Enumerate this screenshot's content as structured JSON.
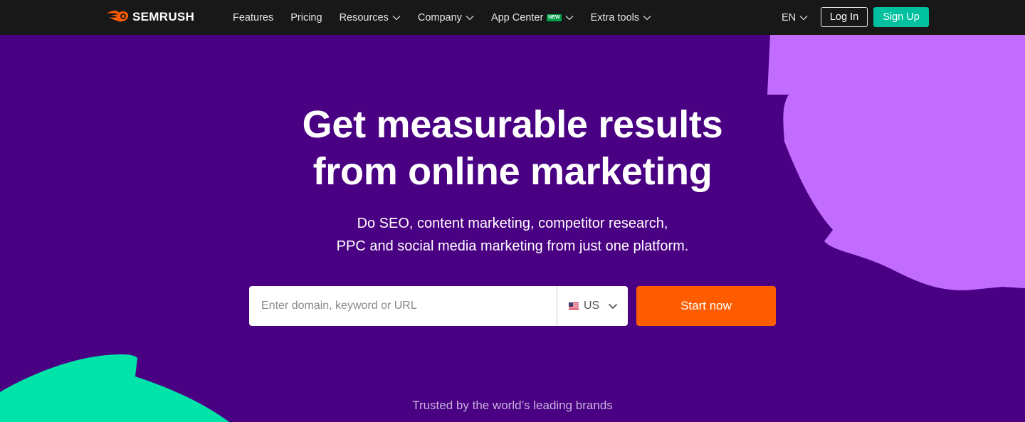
{
  "header": {
    "logo_text": "SEMRUSH",
    "nav": [
      {
        "label": "Features",
        "has_dropdown": false
      },
      {
        "label": "Pricing",
        "has_dropdown": false
      },
      {
        "label": "Resources",
        "has_dropdown": true
      },
      {
        "label": "Company",
        "has_dropdown": true
      },
      {
        "label": "App Center",
        "has_dropdown": true,
        "badge": "NEW"
      },
      {
        "label": "Extra tools",
        "has_dropdown": true
      }
    ],
    "language": "EN",
    "login_label": "Log In",
    "signup_label": "Sign Up"
  },
  "hero": {
    "title_line1": "Get measurable results",
    "title_line2": "from online marketing",
    "subtitle_line1": "Do SEO, content marketing, competitor research,",
    "subtitle_line2": "PPC and social media marketing from just one platform."
  },
  "search": {
    "placeholder": "Enter domain, keyword or URL",
    "value": "",
    "database": "US",
    "database_flag": "us-flag-icon",
    "start_label": "Start now"
  },
  "trusted_text": "Trusted by the world’s leading brands",
  "colors": {
    "background": "#4a0083",
    "topbar": "#181818",
    "accent_orange": "#ff5c00",
    "signup_green": "#00c0a0",
    "blob_purple": "#c26cff",
    "blob_green": "#00e4aa"
  }
}
